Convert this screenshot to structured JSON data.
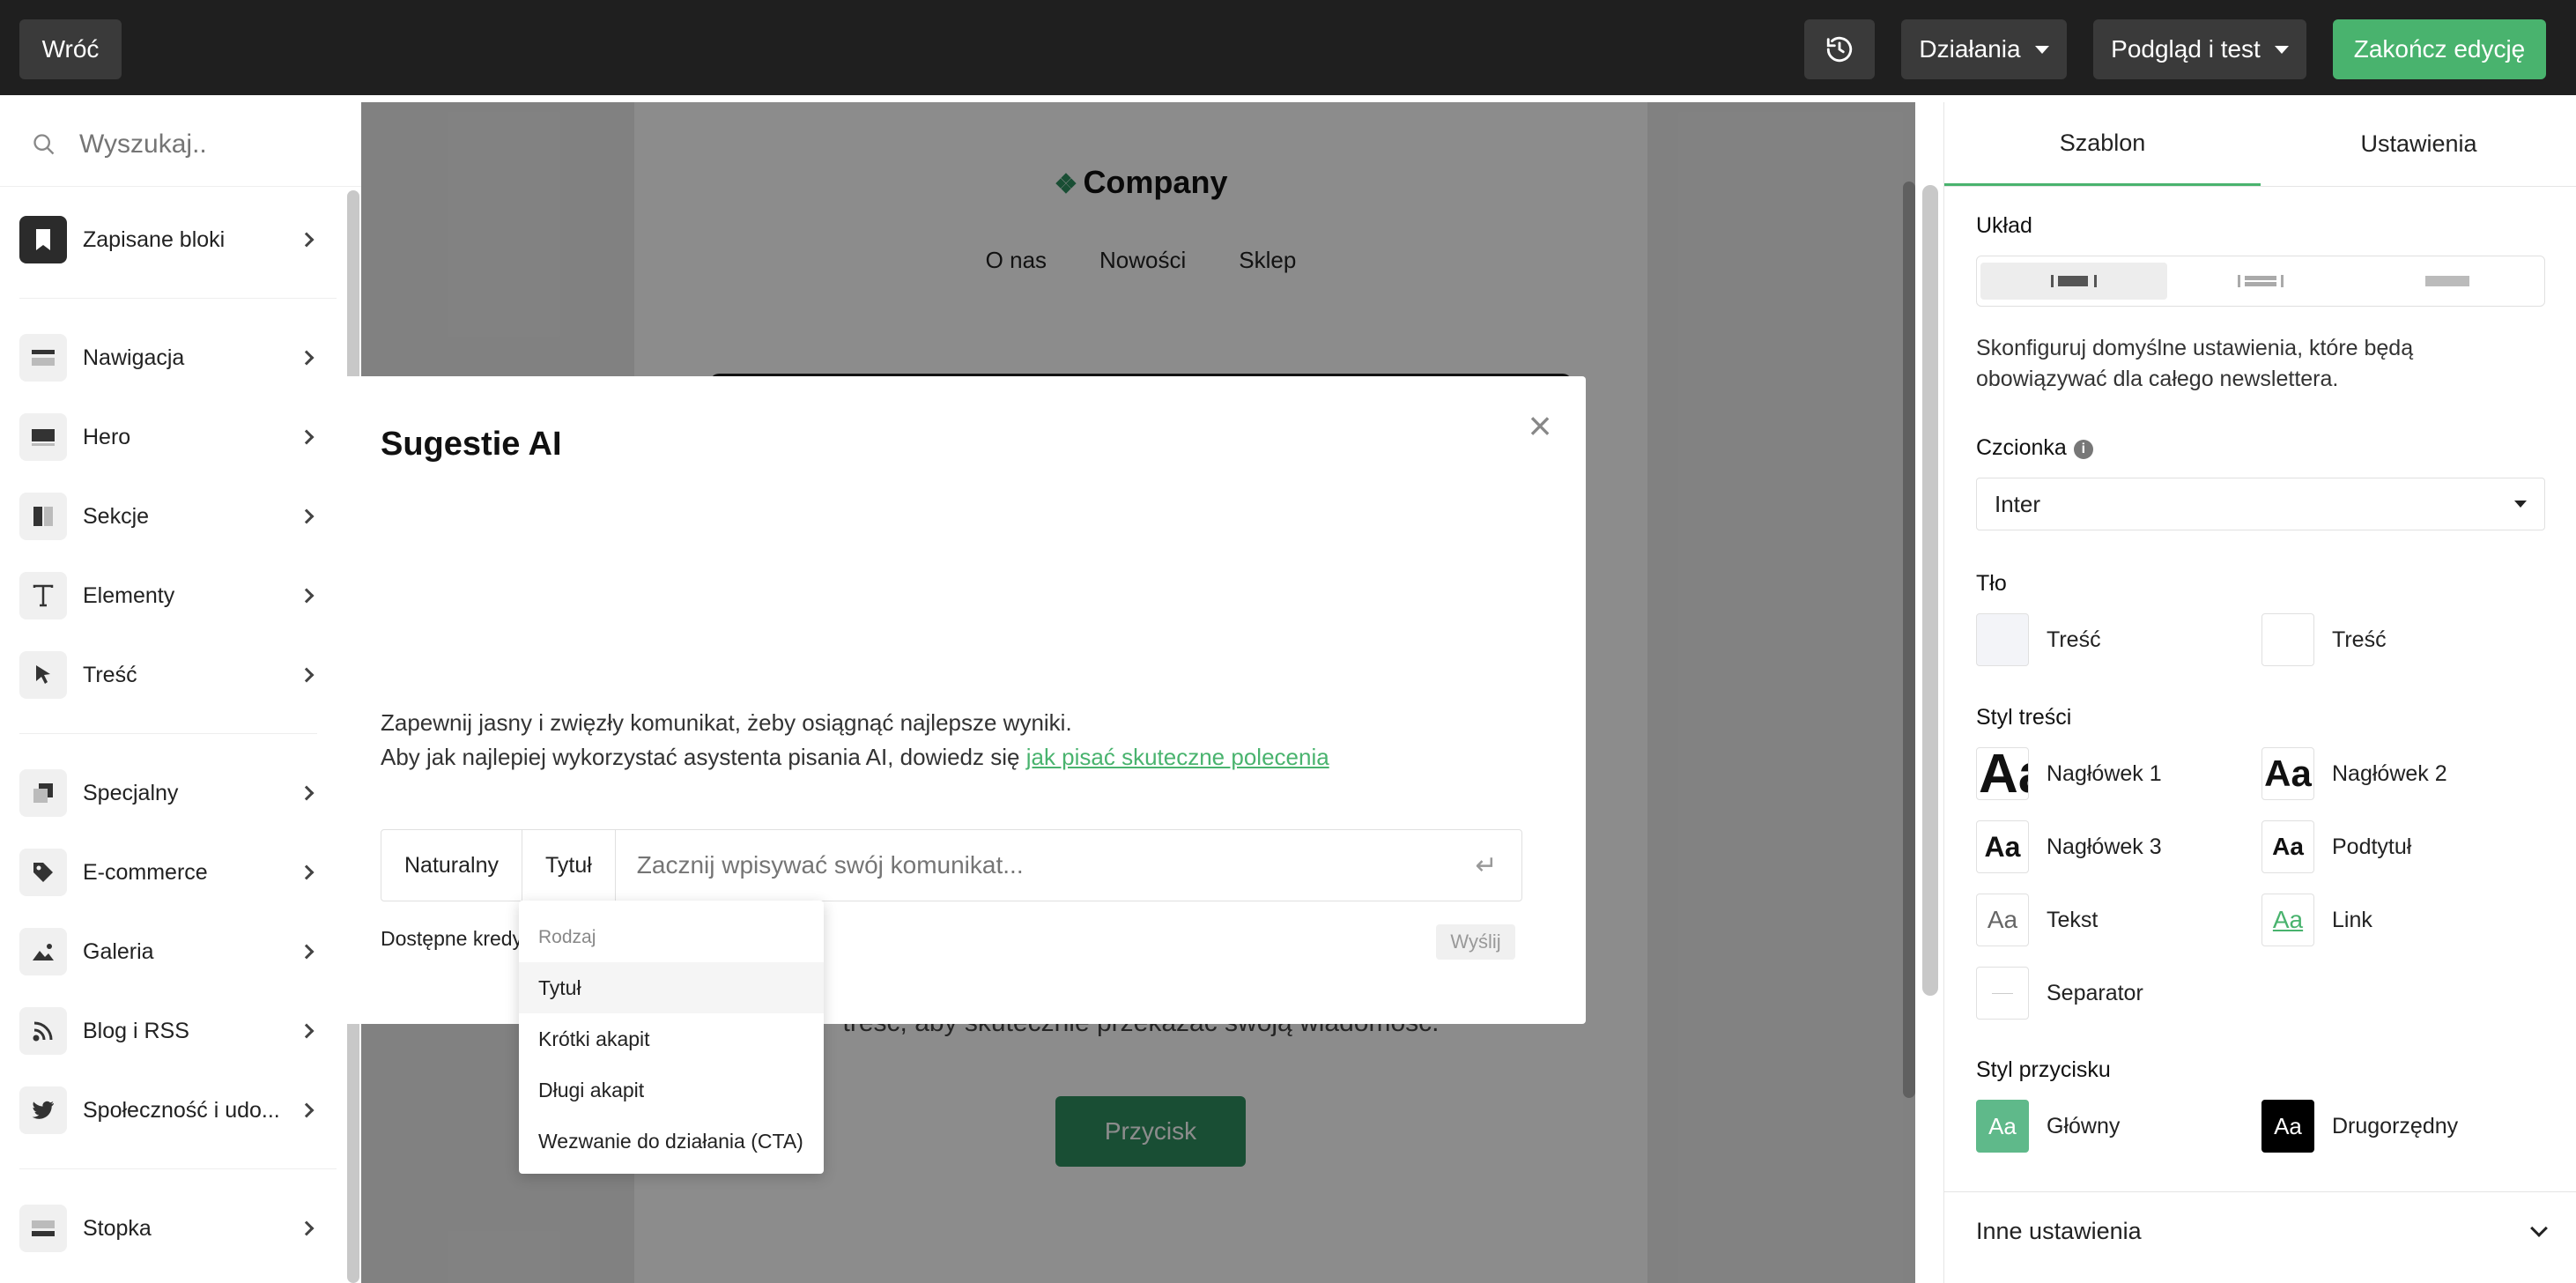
{
  "topbar": {
    "back_label": "Wróć",
    "history_icon": "history-icon",
    "actions_label": "Działania",
    "preview_label": "Podgląd i test",
    "finish_label": "Zakończ edycję",
    "finish_color": "#49b36e"
  },
  "sidebar": {
    "search_placeholder": "Wyszukaj..",
    "items": [
      {
        "label": "Zapisane bloki",
        "icon": "bookmark-icon"
      },
      {
        "label": "Nawigacja",
        "icon": "navigation-icon"
      },
      {
        "label": "Hero",
        "icon": "hero-icon"
      },
      {
        "label": "Sekcje",
        "icon": "sections-icon"
      },
      {
        "label": "Elementy",
        "icon": "text-icon"
      },
      {
        "label": "Treść",
        "icon": "cursor-icon"
      },
      {
        "label": "Specjalny",
        "icon": "special-icon"
      },
      {
        "label": "E-commerce",
        "icon": "tag-icon"
      },
      {
        "label": "Galeria",
        "icon": "image-icon"
      },
      {
        "label": "Blog i RSS",
        "icon": "rss-icon"
      },
      {
        "label": "Społeczność i udo...",
        "icon": "twitter-icon"
      },
      {
        "label": "Stopka",
        "icon": "footer-icon"
      }
    ]
  },
  "canvas": {
    "company": "Company",
    "nav": [
      "O nas",
      "Nowości",
      "Sklep"
    ],
    "paragraph_fragment": "treść, aby skutecznie przekazać swoją wiadomość.",
    "button": "Przycisk"
  },
  "modal": {
    "title": "Sugestie AI",
    "line1": "Zapewnij jasny i zwięzły komunikat, żeby osiągnąć najlepsze wyniki.",
    "line2_prefix": "Aby jak najlepiej wykorzystać asystenta pisania AI, dowiedz się ",
    "line2_link": "jak pisać skuteczne polecenia",
    "tone": "Naturalny",
    "type": "Tytuł",
    "input_placeholder": "Zacznij wpisywać swój komunikat...",
    "credits": "Dostępne kredy",
    "send": "Wyślij",
    "dropdown": {
      "header": "Rodzaj",
      "items": [
        "Tytuł",
        "Krótki akapit",
        "Długi akapit",
        "Wezwanie do działania (CTA)"
      ],
      "selected": "Tytuł"
    }
  },
  "panel": {
    "tabs": [
      "Szablon",
      "Ustawienia"
    ],
    "layout_label": "Układ",
    "description": "Skonfiguruj domyślne ustawienia, które będą obowiązywać dla całego newslettera.",
    "font_label": "Czcionka",
    "font_value": "Inter",
    "bg_label": "Tło",
    "bg": [
      {
        "label": "Treść",
        "color": "#f3f4f8"
      },
      {
        "label": "Treść",
        "color": "#ffffff"
      }
    ],
    "content_style_label": "Styl treści",
    "styles": [
      {
        "label": "Nagłówek 1",
        "sample": "Aa"
      },
      {
        "label": "Nagłówek 2",
        "sample": "Aa"
      },
      {
        "label": "Nagłówek 3",
        "sample": "Aa"
      },
      {
        "label": "Podtytuł",
        "sample": "Aa"
      },
      {
        "label": "Tekst",
        "sample": "Aa"
      },
      {
        "label": "Link",
        "sample": "Aa"
      },
      {
        "label": "Separator",
        "sample": ""
      }
    ],
    "button_style_label": "Styl przycisku",
    "buttons": [
      {
        "label": "Główny",
        "sample": "Aa",
        "color": "#5fb98a"
      },
      {
        "label": "Drugorzędny",
        "sample": "Aa",
        "color": "#000000"
      }
    ],
    "other_settings": "Inne ustawienia"
  }
}
